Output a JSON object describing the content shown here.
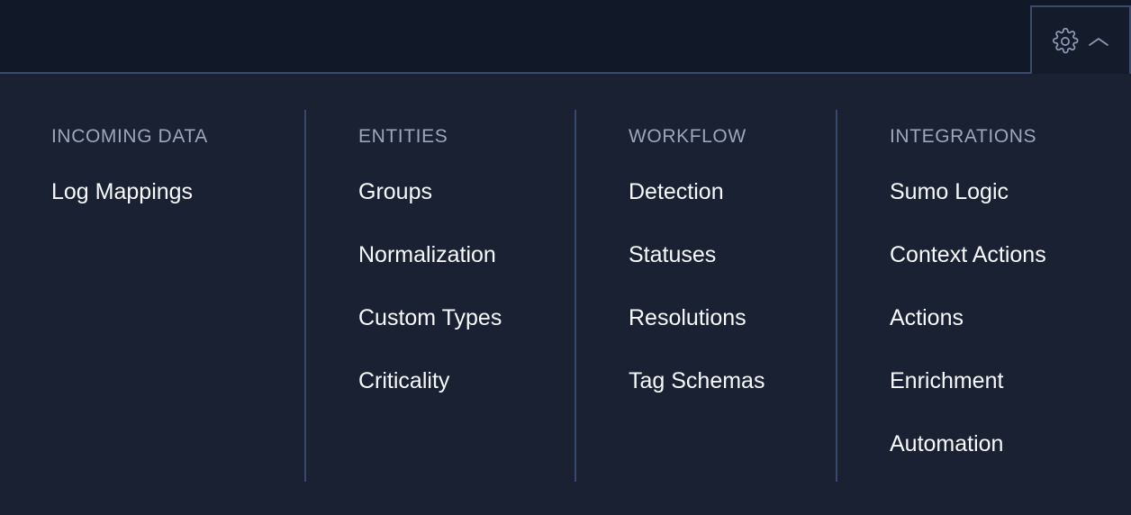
{
  "colors": {
    "header_bg": "#111827",
    "panel_bg": "#1a2132",
    "divider": "#39486b",
    "border": "#3b4a6b",
    "title_text": "#9aa7bd",
    "item_text": "#f7f9fc",
    "icon_stroke": "#8c9bb5"
  },
  "topbar": {
    "settings_button": {
      "gear_icon": "gear-icon",
      "chevron_icon": "chevron-up-icon",
      "label": ""
    }
  },
  "menu": {
    "columns": [
      {
        "title": "INCOMING DATA",
        "items": [
          {
            "label": "Log Mappings"
          }
        ]
      },
      {
        "title": "ENTITIES",
        "items": [
          {
            "label": "Groups"
          },
          {
            "label": "Normalization"
          },
          {
            "label": "Custom Types"
          },
          {
            "label": "Criticality"
          }
        ]
      },
      {
        "title": "WORKFLOW",
        "items": [
          {
            "label": "Detection"
          },
          {
            "label": "Statuses"
          },
          {
            "label": "Resolutions"
          },
          {
            "label": "Tag Schemas"
          }
        ]
      },
      {
        "title": "INTEGRATIONS",
        "items": [
          {
            "label": "Sumo Logic"
          },
          {
            "label": "Context Actions"
          },
          {
            "label": "Actions"
          },
          {
            "label": "Enrichment"
          },
          {
            "label": "Automation"
          }
        ]
      }
    ]
  }
}
